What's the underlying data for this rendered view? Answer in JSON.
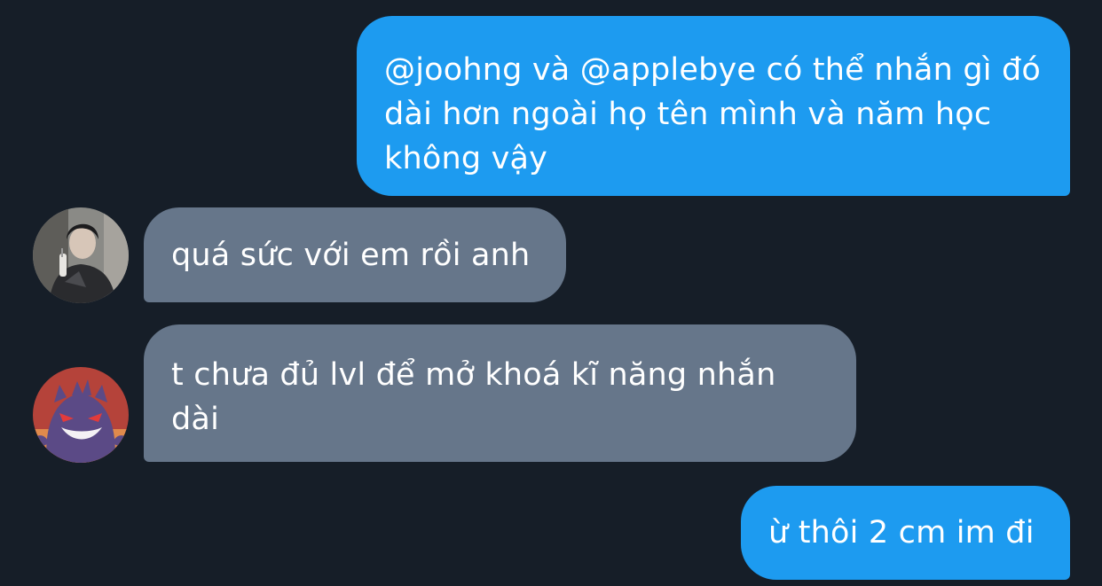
{
  "conversation": {
    "messages": [
      {
        "direction": "outgoing",
        "text": "@joohng và @applebye có thể nhắn gì đó dài hơn ngoài họ tên mình và năm học không vậy"
      },
      {
        "direction": "incoming",
        "avatar_icon": "user-photo-avatar",
        "text": "quá sức với em rồi anh"
      },
      {
        "direction": "incoming",
        "avatar_icon": "gengar-avatar",
        "text": "t chưa đủ lvl để mở khoá kĩ năng nhắn dài"
      },
      {
        "direction": "outgoing",
        "text": "ừ thôi 2 cm im đi"
      }
    ]
  },
  "colors": {
    "background": "#161e28",
    "outgoing_bubble": "#1d9bf0",
    "incoming_bubble": "#66768a",
    "text": "#ffffff"
  }
}
